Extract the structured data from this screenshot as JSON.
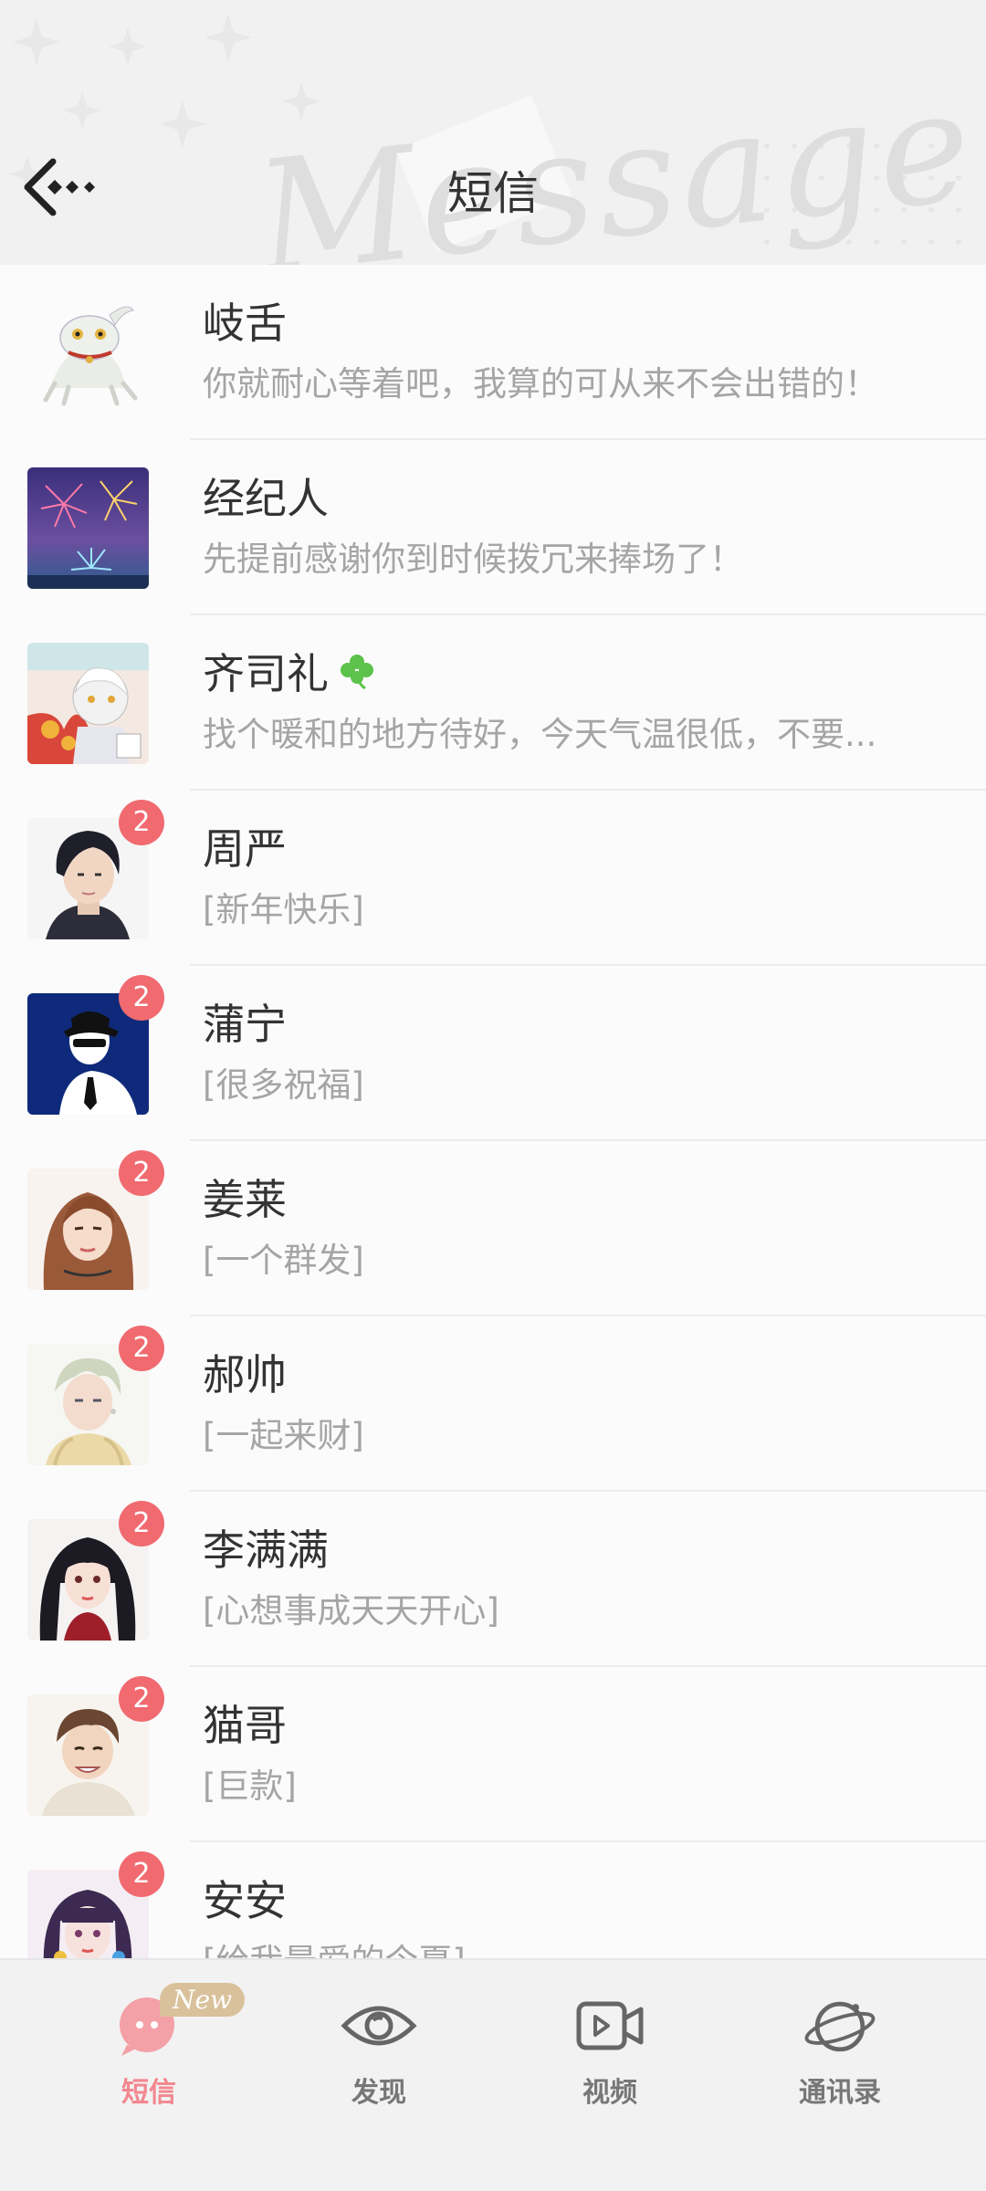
{
  "header": {
    "title": "短信",
    "watermark": "Message"
  },
  "contacts": [
    {
      "name": "岐舌",
      "preview": "你就耐心等着吧，我算的可从来不会出错的！",
      "badge": ""
    },
    {
      "name": "经纪人",
      "preview": "先提前感谢你到时候拨冗来捧场了！",
      "badge": ""
    },
    {
      "name": "齐司礼",
      "preview": "找个暖和的地方待好，今天气温很低，不要...",
      "badge": "",
      "name_icon": "clover-icon"
    },
    {
      "name": "周严",
      "preview": "[新年快乐]",
      "badge": "2"
    },
    {
      "name": "蒲宁",
      "preview": "[很多祝福]",
      "badge": "2"
    },
    {
      "name": "姜莱",
      "preview": "[一个群发]",
      "badge": "2"
    },
    {
      "name": "郝帅",
      "preview": "[一起来财]",
      "badge": "2"
    },
    {
      "name": "李满满",
      "preview": "[心想事成天天开心]",
      "badge": "2"
    },
    {
      "name": "猫哥",
      "preview": "[巨款]",
      "badge": "2"
    },
    {
      "name": "安安",
      "preview": "[给我最爱的今夏]",
      "badge": "2"
    }
  ],
  "nav": {
    "new_tag": "New",
    "items": [
      {
        "label": "短信",
        "icon": "message-bubble-icon",
        "active": true
      },
      {
        "label": "发现",
        "icon": "eye-icon",
        "active": false
      },
      {
        "label": "视频",
        "icon": "video-icon",
        "active": false
      },
      {
        "label": "通讯录",
        "icon": "planet-icon",
        "active": false
      }
    ]
  },
  "colors": {
    "accent": "#f2878f",
    "badge": "#f06a70",
    "text_primary": "#333333",
    "text_secondary": "#a5a5a5"
  }
}
